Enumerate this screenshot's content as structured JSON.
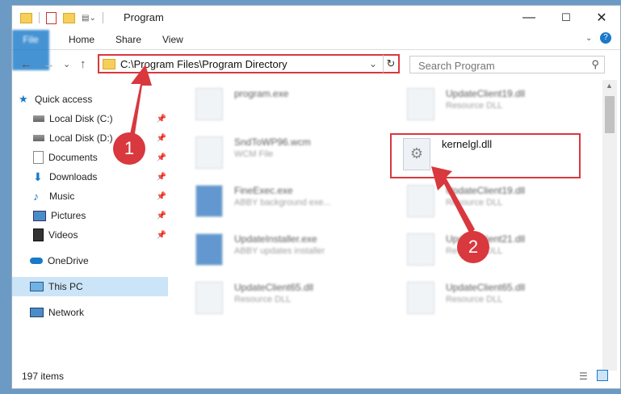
{
  "window": {
    "title": "Program",
    "controls": {
      "minimize": "—",
      "maximize": "☐",
      "close": "✕"
    }
  },
  "ribbon": {
    "tabs": [
      "File",
      "Home",
      "Share",
      "View"
    ],
    "help": "?"
  },
  "address_bar": {
    "path": "C:\\Program Files\\Program Directory",
    "dropdown": "⌄",
    "refresh": "↻"
  },
  "search": {
    "placeholder": "Search Program",
    "icon": "search-icon"
  },
  "nav_buttons": {
    "back": "←",
    "forward": "→",
    "recent": "⌄",
    "up": "↑"
  },
  "sidebar": {
    "items": [
      {
        "label": "Quick access",
        "icon": "star-icon"
      },
      {
        "label": "Local Disk (C:)",
        "icon": "drive-icon",
        "pinned": true
      },
      {
        "label": "Local Disk (D:)",
        "icon": "drive-icon",
        "pinned": true
      },
      {
        "label": "Documents",
        "icon": "documents-icon",
        "pinned": true
      },
      {
        "label": "Downloads",
        "icon": "download-icon",
        "pinned": true
      },
      {
        "label": "Music",
        "icon": "music-icon",
        "pinned": true
      },
      {
        "label": "Pictures",
        "icon": "pictures-icon",
        "pinned": true
      },
      {
        "label": "Videos",
        "icon": "video-icon",
        "pinned": true
      },
      {
        "label": "OneDrive",
        "icon": "cloud-icon"
      },
      {
        "label": "This PC",
        "icon": "computer-icon",
        "selected": true
      },
      {
        "label": "Network",
        "icon": "network-icon"
      }
    ]
  },
  "files": [
    {
      "name": "program.exe",
      "type": ""
    },
    {
      "name": "UpdateClient19.dll",
      "type": "Resource DLL"
    },
    {
      "name": "SndToWP96.wcm",
      "type": "WCM File"
    },
    {
      "name": "kernelgl.dll",
      "type": ""
    },
    {
      "name": "FineExec.exe",
      "type": "ABBY background exe..."
    },
    {
      "name": "UpdateClient19.dll",
      "type": "Resource DLL"
    },
    {
      "name": "UpdateInstaller.exe",
      "type": "ABBY updates installer"
    },
    {
      "name": "UpdateClient21.dll",
      "type": "Resource DLL"
    },
    {
      "name": "UpdateClient65.dll",
      "type": "Resource DLL"
    },
    {
      "name": "UpdateClient65.dll",
      "type": "Resource DLL"
    }
  ],
  "status": {
    "count": "197 items"
  },
  "annotations": {
    "step1": "1",
    "step2": "2"
  },
  "colors": {
    "accent": "#1979ca",
    "annotation": "#d9383e",
    "selection": "#cce4f7"
  }
}
